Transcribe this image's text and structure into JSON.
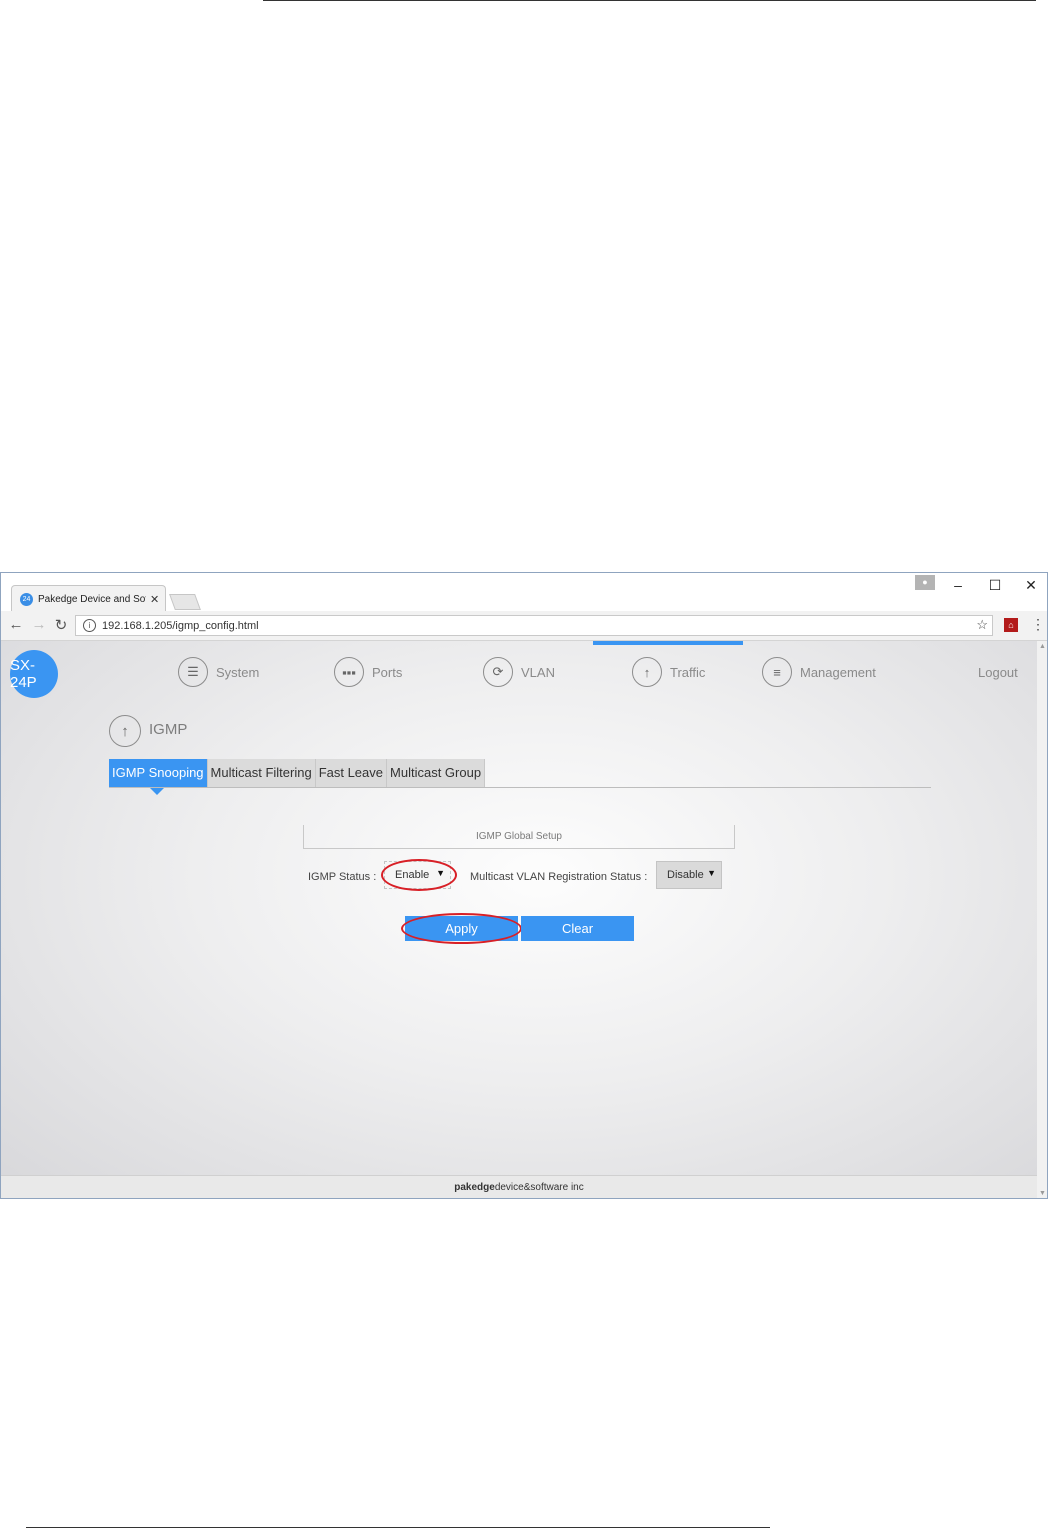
{
  "browser": {
    "tab_title": "Pakedge Device and Soft",
    "tab_favicon": "24",
    "url": "192.168.1.205/igmp_config.html",
    "icons": {
      "back": "arrow-left-icon",
      "forward": "arrow-right-icon",
      "reload": "reload-icon",
      "info": "info-icon",
      "star": "star-icon",
      "pdf": "pdf-extension-icon",
      "menu": "more-vertical-icon",
      "profile": "profile-icon",
      "minimize": "minimize-icon",
      "maximize": "maximize-icon",
      "close": "close-icon"
    }
  },
  "app": {
    "logo": "SX-24P",
    "nav": [
      {
        "label": "System",
        "icon": "sliders-icon"
      },
      {
        "label": "Ports",
        "icon": "ports-icon"
      },
      {
        "label": "VLAN",
        "icon": "network-icon"
      },
      {
        "label": "Traffic",
        "icon": "arrow-up-icon",
        "active": true
      },
      {
        "label": "Management",
        "icon": "menu-lines-icon"
      }
    ],
    "logout": "Logout",
    "accent_color": "#3a95f2"
  },
  "section": {
    "title": "IGMP",
    "icon": "arrow-up-icon"
  },
  "subtabs": [
    {
      "label": "IGMP Snooping",
      "active": true
    },
    {
      "label": "Multicast Filtering"
    },
    {
      "label": "Fast Leave"
    },
    {
      "label": "Multicast Group"
    }
  ],
  "form": {
    "panel_title": "IGMP Global Setup",
    "igmp_status_label": "IGMP Status :",
    "igmp_status_value": "Enable",
    "mvr_status_label": "Multicast VLAN Registration Status :",
    "mvr_status_value": "Disable",
    "apply_label": "Apply",
    "clear_label": "Clear",
    "highlight_color": "#d81f26"
  },
  "footer": {
    "brand_bold": "pakedge",
    "brand_rest": "device&software inc"
  }
}
